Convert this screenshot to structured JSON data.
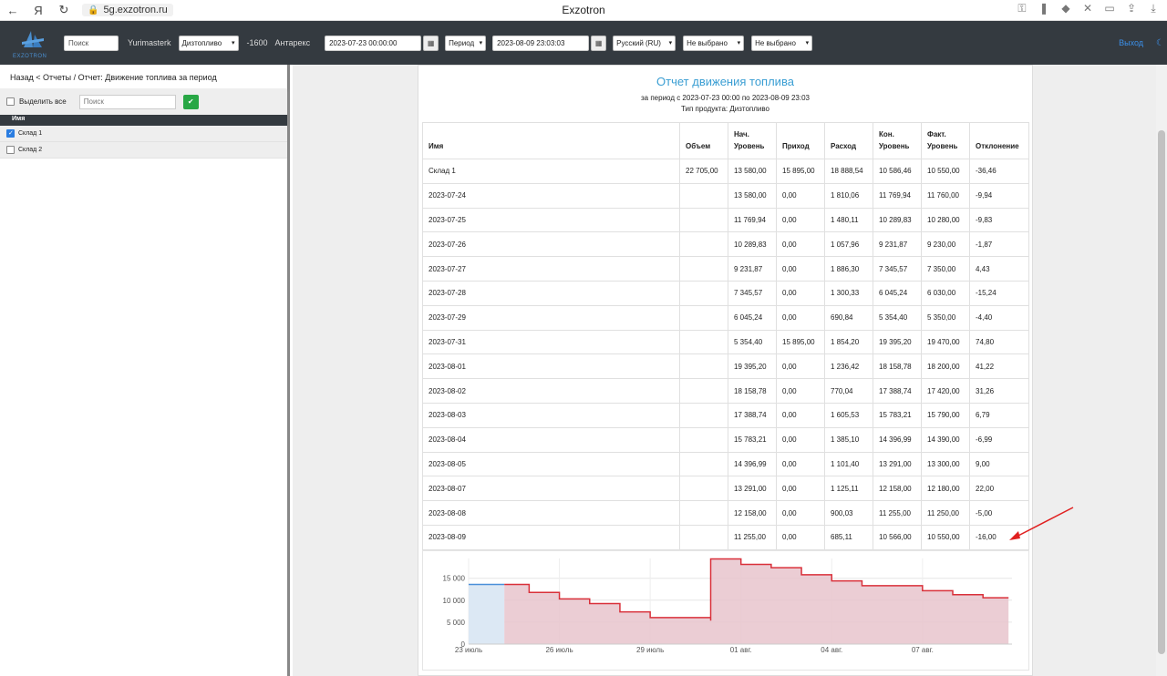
{
  "browser": {
    "address": "5g.exzotron.ru",
    "title": "Exzotron"
  },
  "nav": {
    "logo_text": "EXZOTRON",
    "search_placeholder": "Поиск",
    "user": "Yurimasterk",
    "fuel_select": "Дизтопливо",
    "balance": "-1600",
    "company": "Антарекс",
    "date_from": "2023-07-23 00:00:00",
    "period_label": "Период",
    "date_to": "2023-08-09 23:03:03",
    "lang_select": "Русский (RU)",
    "filter1": "Не выбрано",
    "filter2": "Не выбрано",
    "logout": "Выход"
  },
  "sidebar": {
    "breadcrumb": "Назад < Отчеты / Отчет: Движение топлива за период",
    "select_all": "Выделить все",
    "search_placeholder": "Поиск",
    "header": "Имя",
    "items": [
      {
        "label": "Склад 1",
        "checked": true
      },
      {
        "label": "Склад 2",
        "checked": false
      }
    ]
  },
  "report": {
    "title": "Отчет движения топлива",
    "period": "за период с 2023-07-23 00:00 по 2023-08-09 23:03",
    "product": "Тип продукта: Дизтопливо",
    "columns": [
      "Имя",
      "Объем",
      "Нач. Уровень",
      "Приход",
      "Расход",
      "Кон. Уровень",
      "Факт. Уровень",
      "Отклонение"
    ],
    "rows": [
      [
        "Склад 1",
        "22 705,00",
        "13 580,00",
        "15 895,00",
        "18 888,54",
        "10 586,46",
        "10 550,00",
        "-36,46"
      ],
      [
        "2023-07-24",
        "",
        "13 580,00",
        "0,00",
        "1 810,06",
        "11 769,94",
        "11 760,00",
        "-9,94"
      ],
      [
        "2023-07-25",
        "",
        "11 769,94",
        "0,00",
        "1 480,11",
        "10 289,83",
        "10 280,00",
        "-9,83"
      ],
      [
        "2023-07-26",
        "",
        "10 289,83",
        "0,00",
        "1 057,96",
        "9 231,87",
        "9 230,00",
        "-1,87"
      ],
      [
        "2023-07-27",
        "",
        "9 231,87",
        "0,00",
        "1 886,30",
        "7 345,57",
        "7 350,00",
        "4,43"
      ],
      [
        "2023-07-28",
        "",
        "7 345,57",
        "0,00",
        "1 300,33",
        "6 045,24",
        "6 030,00",
        "-15,24"
      ],
      [
        "2023-07-29",
        "",
        "6 045,24",
        "0,00",
        "690,84",
        "5 354,40",
        "5 350,00",
        "-4,40"
      ],
      [
        "2023-07-31",
        "",
        "5 354,40",
        "15 895,00",
        "1 854,20",
        "19 395,20",
        "19 470,00",
        "74,80"
      ],
      [
        "2023-08-01",
        "",
        "19 395,20",
        "0,00",
        "1 236,42",
        "18 158,78",
        "18 200,00",
        "41,22"
      ],
      [
        "2023-08-02",
        "",
        "18 158,78",
        "0,00",
        "770,04",
        "17 388,74",
        "17 420,00",
        "31,26"
      ],
      [
        "2023-08-03",
        "",
        "17 388,74",
        "0,00",
        "1 605,53",
        "15 783,21",
        "15 790,00",
        "6,79"
      ],
      [
        "2023-08-04",
        "",
        "15 783,21",
        "0,00",
        "1 385,10",
        "14 396,99",
        "14 390,00",
        "-6,99"
      ],
      [
        "2023-08-05",
        "",
        "14 396,99",
        "0,00",
        "1 101,40",
        "13 291,00",
        "13 300,00",
        "9,00"
      ],
      [
        "2023-08-07",
        "",
        "13 291,00",
        "0,00",
        "1 125,11",
        "12 158,00",
        "12 180,00",
        "22,00"
      ],
      [
        "2023-08-08",
        "",
        "12 158,00",
        "0,00",
        "900,03",
        "11 255,00",
        "11 250,00",
        "-5,00"
      ],
      [
        "2023-08-09",
        "",
        "11 255,00",
        "0,00",
        "685,11",
        "10 566,00",
        "10 550,00",
        "-16,00"
      ]
    ]
  },
  "chart_data": {
    "type": "area",
    "title": "",
    "xlabel": "",
    "ylabel": "",
    "yticks": [
      "0",
      "5 000",
      "10 000",
      "15 000"
    ],
    "ylim": [
      0,
      19500
    ],
    "xticks": [
      "23 июль",
      "26 июль",
      "29 июль",
      "01 авг.",
      "04 авг.",
      "07 авг."
    ],
    "x": [
      "2023-07-23",
      "2023-07-24",
      "2023-07-25",
      "2023-07-26",
      "2023-07-27",
      "2023-07-28",
      "2023-07-29",
      "2023-07-31",
      "2023-07-31",
      "2023-08-01",
      "2023-08-02",
      "2023-08-03",
      "2023-08-04",
      "2023-08-05",
      "2023-08-07",
      "2023-08-08",
      "2023-08-09"
    ],
    "series": [
      {
        "values": [
          13580,
          13580,
          11770,
          10290,
          9232,
          7346,
          6045,
          5354,
          19395,
          18159,
          17389,
          15783,
          14397,
          13291,
          12158,
          11255,
          10566
        ]
      }
    ],
    "colors": {
      "line": "#d9303a",
      "fill": "#e8c4cc",
      "blue": "#4a90d9"
    }
  }
}
